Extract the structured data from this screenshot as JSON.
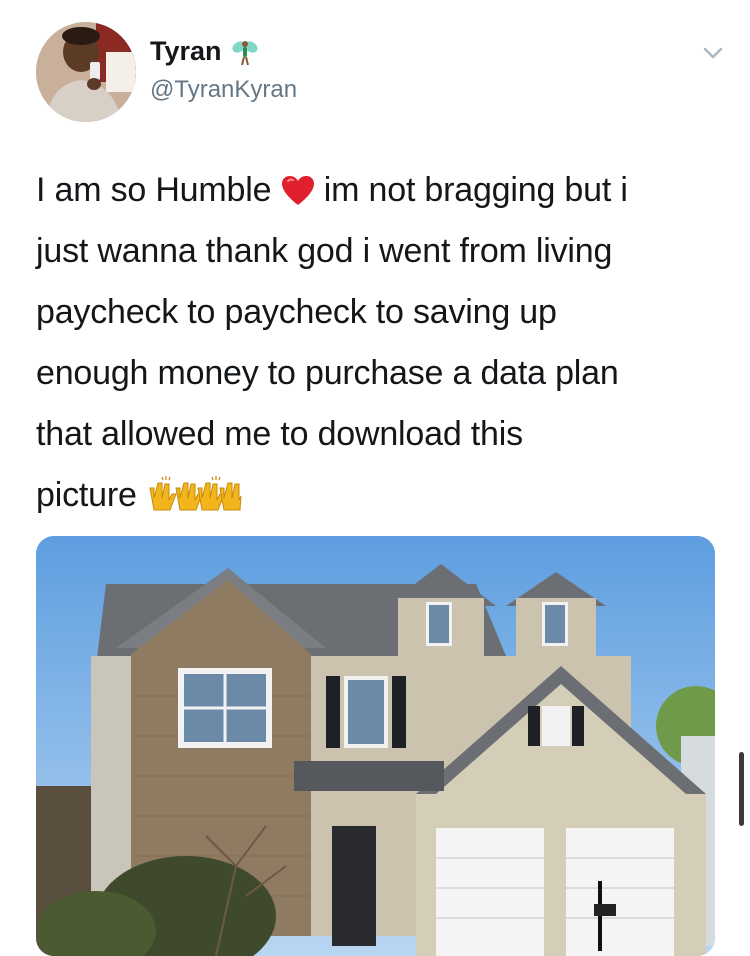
{
  "user": {
    "display_name": "Tyran",
    "handle": "@TyranKyran",
    "name_emoji": "fairy-icon",
    "avatar": "profile-photo"
  },
  "menu": {
    "icon": "chevron-down-icon"
  },
  "tweet": {
    "line1a": "I am so Humble",
    "line1b": "im not bragging but i",
    "line2": "just wanna thank god i went from living",
    "line3": "paycheck to paycheck to saving up",
    "line4": "enough money to purchase a data plan",
    "line5": "that allowed me to download this",
    "line6": "picture",
    "emojis": [
      "red-heart-icon",
      "raising-hands-icon",
      "raising-hands-icon"
    ]
  },
  "media": {
    "subject": "two-story suburban house photo"
  },
  "colors": {
    "text": "#14171a",
    "secondary": "#657786",
    "heart": "#e0202c",
    "hands": "#f2b51c"
  }
}
